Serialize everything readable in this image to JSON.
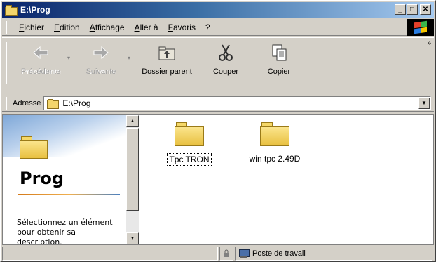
{
  "window": {
    "title": "E:\\Prog",
    "controls": [
      "minimize-button",
      "maximize-button",
      "close-button"
    ]
  },
  "menu": {
    "items": [
      "Fichier",
      "Edition",
      "Affichage",
      "Aller à",
      "Favoris",
      "?"
    ]
  },
  "toolbar": {
    "back_label": "Précédente",
    "forward_label": "Suivante",
    "up_label": "Dossier parent",
    "cut_label": "Couper",
    "copy_label": "Copier",
    "more": "»"
  },
  "address": {
    "label": "Adresse",
    "value": "E:\\Prog"
  },
  "leftpane": {
    "title": "Prog",
    "description": "Sélectionnez un élément pour obtenir sa description."
  },
  "files": [
    {
      "name": "Tpc TRON",
      "selected": true
    },
    {
      "name": "win tpc 2.49D",
      "selected": false
    }
  ],
  "statusbar": {
    "zone": "Poste de travail"
  },
  "colors": {
    "titlebar_start": "#0a246a",
    "titlebar_end": "#a6caf0",
    "window_bg": "#d4d0c8",
    "folder": "#f3d56b"
  }
}
